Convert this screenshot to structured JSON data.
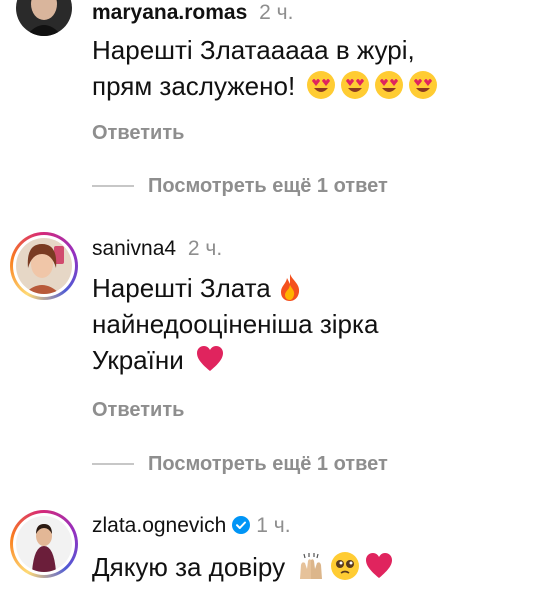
{
  "comments": [
    {
      "username": "maryana.romas",
      "time": "2 ч.",
      "lines": [
        "Нарешті Златаааaа в журі,",
        "прям заслужено!"
      ],
      "emojis": [
        "heart-eyes-emoji",
        "heart-eyes-emoji",
        "heart-eyes-emoji",
        "heart-eyes-emoji"
      ],
      "reply_label": "Ответить",
      "view_replies_label": "Посмотреть ещё 1 ответ"
    },
    {
      "username": "sanivna4",
      "time": "2 ч.",
      "lines": [
        "Нарешті Злата",
        "найнедооціненіша зірка",
        "України"
      ],
      "emojis": [
        "fire-emoji",
        "red-heart-emoji"
      ],
      "reply_label": "Ответить",
      "view_replies_label": "Посмотреть ещё 1 ответ"
    },
    {
      "username": "zlata.ognevich",
      "time": "1 ч.",
      "verified": true,
      "lines": [
        "Дякую за довіру"
      ],
      "emojis": [
        "raising-hands-emoji",
        "pleading-face-emoji",
        "red-heart-emoji"
      ]
    }
  ],
  "colors": {
    "text": "#111111",
    "secondary": "#8e8e8e",
    "verified": "#0095f6",
    "heart": "#e0245e"
  }
}
